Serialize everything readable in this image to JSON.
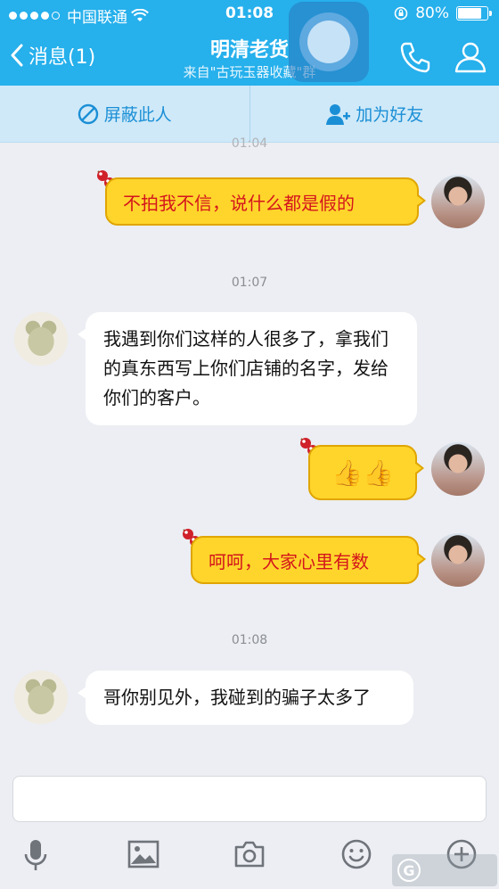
{
  "status_bar": {
    "carrier": "中国联通",
    "time": "01:08",
    "battery": "80%",
    "battery_level": 0.8
  },
  "header": {
    "back_label": "消息(1)",
    "title": "明清老货",
    "subtitle": "来自\"古玩玉器收藏\"群"
  },
  "actions": {
    "block": "屏蔽此人",
    "add_friend": "加为好友"
  },
  "timestamps": [
    "01:04",
    "01:07",
    "01:08"
  ],
  "messages": [
    {
      "side": "right",
      "text": "不拍我不信，说什么都是假的"
    },
    {
      "side": "left",
      "text": "我遇到你们这样的人很多了，拿我们的真东西写上你们店铺的名字，发给你们的客户。"
    },
    {
      "side": "right",
      "text": "👍👍"
    },
    {
      "side": "right",
      "text": "呵呵，大家心里有数"
    },
    {
      "side": "left",
      "text": "哥你别见外，我碰到的骗子太多了"
    }
  ],
  "colors": {
    "header": "#26b0ec",
    "action_bar": "#cfe9f8",
    "accent": "#1b8fd6",
    "bubble_out": "#ffd52b",
    "bubble_out_text": "#d4161c",
    "background": "#eceef3"
  },
  "toolbar_icons": [
    "mic-icon",
    "image-icon",
    "camera-icon",
    "emoji-icon",
    "plus-icon"
  ]
}
